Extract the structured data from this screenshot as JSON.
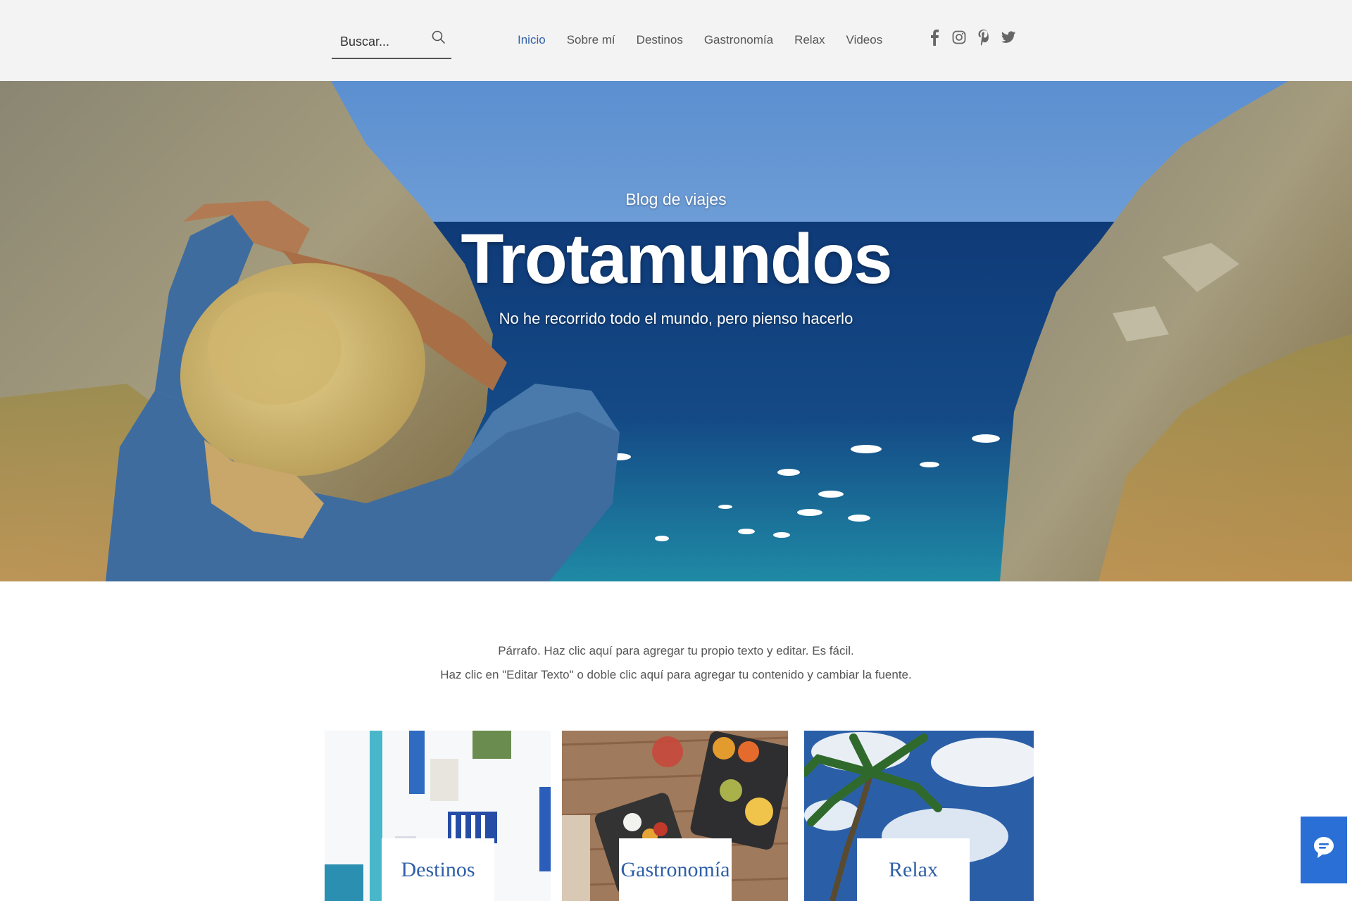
{
  "search": {
    "placeholder": "Buscar..."
  },
  "nav": {
    "items": [
      "Inicio",
      "Sobre mí",
      "Destinos",
      "Gastronomía",
      "Relax",
      "Videos"
    ],
    "active": "Inicio"
  },
  "social": [
    "facebook-icon",
    "instagram-icon",
    "pinterest-icon",
    "twitter-icon"
  ],
  "hero": {
    "kicker": "Blog de viajes",
    "title": "Trotamundos",
    "subtitle": "No he recorrido todo el mundo, pero pienso hacerlo"
  },
  "intro": {
    "line1": "Párrafo. Haz clic aquí para agregar tu propio texto y editar. Es fácil.",
    "line2": "Haz clic en \"Editar Texto\" o doble clic aquí para agregar tu contenido y cambiar la fuente."
  },
  "cards": [
    {
      "label": "Destinos"
    },
    {
      "label": "Gastronomía"
    },
    {
      "label": "Relax"
    }
  ],
  "chat": {
    "icon": "chat-icon"
  },
  "colors": {
    "accent": "#2f5fa7",
    "header_bg": "#f3f3f3",
    "chat_bg": "#2a6fd6"
  }
}
